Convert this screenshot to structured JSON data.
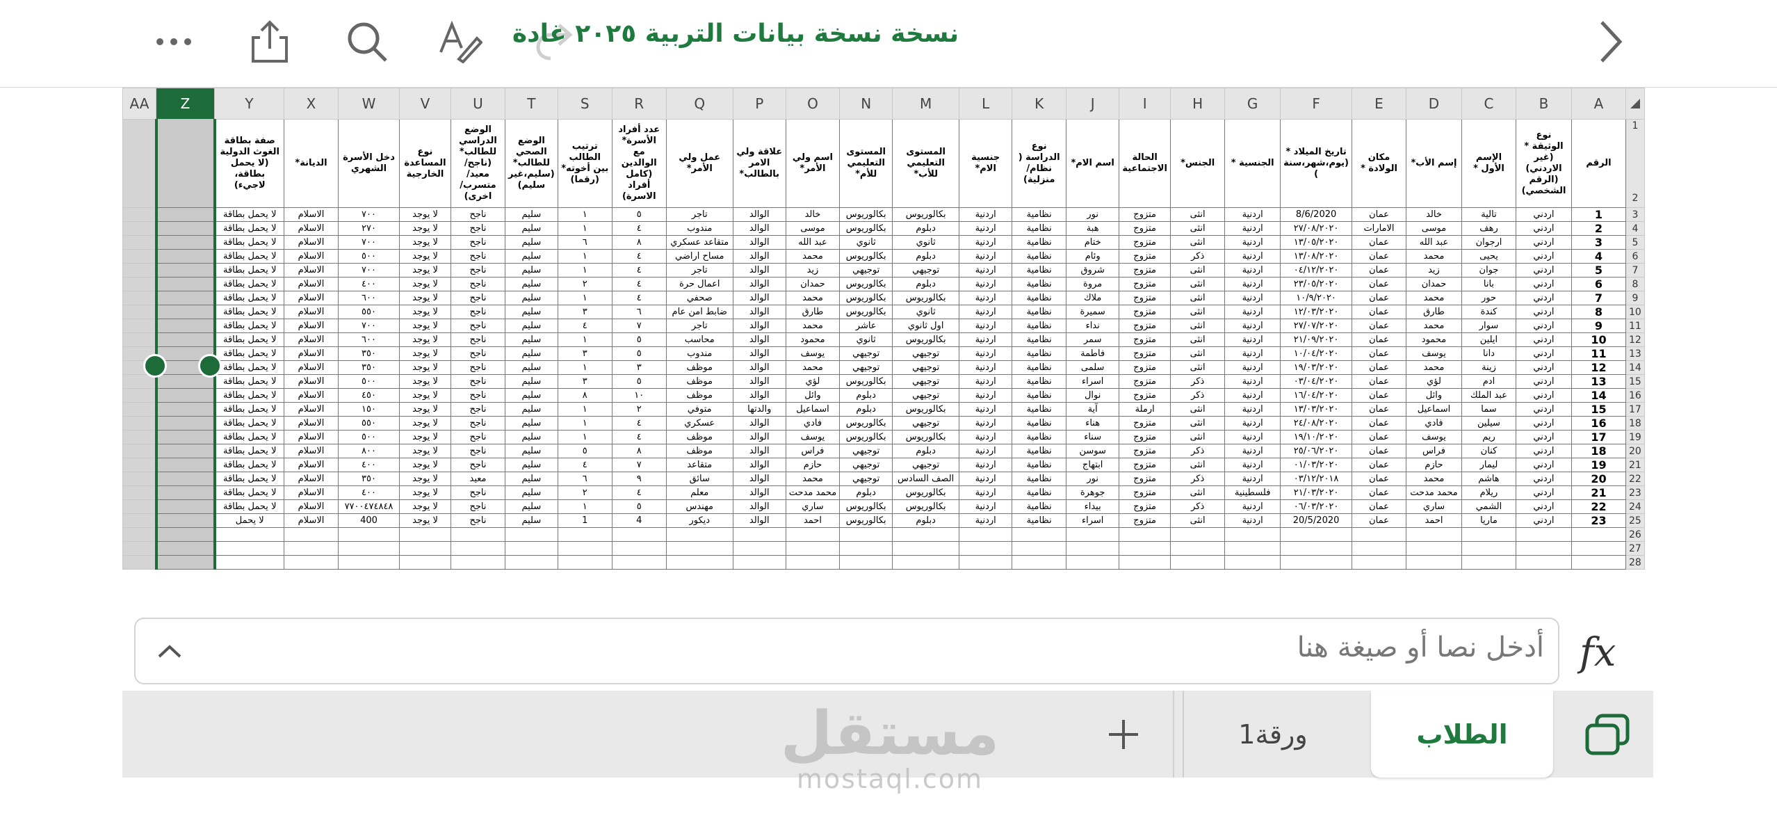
{
  "toolbar": {
    "more_icon": "ellipsis-icon",
    "share_icon": "share-icon",
    "search_icon": "search-icon",
    "format_icon": "text-format-icon",
    "redo_icon": "redo-icon",
    "forward_icon": "chevron-right-icon",
    "title": "نسخة نسخة بيانات التربية ٢٠٢٥ غادة"
  },
  "sheet": {
    "column_letters": [
      "AA",
      "Z",
      "Y",
      "X",
      "W",
      "V",
      "U",
      "T",
      "S",
      "R",
      "Q",
      "P",
      "O",
      "N",
      "M",
      "L",
      "K",
      "J",
      "I",
      "H",
      "G",
      "F",
      "E",
      "D",
      "C",
      "B",
      "A"
    ],
    "selected_column": "Z",
    "headers": [
      "",
      "",
      "صفة بطاقة الغوث الدولية (لا يحمل بطاقة، لاجيء)",
      "الديانة*",
      "دخل الأسرة الشهري",
      "نوع المساعدة الخارجية",
      "الوضع الدراسي للطالب* (ناجح/ معيد/ متسرب/ اخرى)",
      "الوضع الصحي للطالب* (سليم،غير سليم)",
      "ترتيب الطالب بين أخوته* (رقما)",
      "عدد أفراد الأسرة* مع الوالدين (كامل أفراد الاسرة)",
      "عمل ولي الأمر*",
      "علاقة ولي الامر بالطالب*",
      "اسم ولي الأمر*",
      "المستوى التعليمي للأم*",
      "المستوى التعليمي للأب*",
      "جنسية الام*",
      "نوع الدراسة ( نظام/ منزلية)",
      "اسم الام*",
      "الحالة الاجتماعية",
      "الجنس*",
      "الجنسية *",
      "تاريخ الميلاد * (يوم،شهر،سنة )",
      "مكان الولادة *",
      "إسم الأب*",
      "الإسم الأول *",
      "نوع الوثيقة * (غير الاردني) (الرقم الشخصي)",
      "الرقم"
    ],
    "header_row_numbers": [
      "1",
      "2"
    ],
    "rows": [
      {
        "n": "3",
        "c": [
          "",
          "",
          "لا يحمل بطاقة",
          "الاسلام",
          "٧٠٠",
          "لا يوجد",
          "ناجح",
          "سليم",
          "١",
          "٥",
          "تاجر",
          "الوالد",
          "خالد",
          "بكالوريوس",
          "بكالوريوس",
          "اردنية",
          "نظامية",
          "نور",
          "متزوج",
          "انثى",
          "اردنية",
          "8/6/2020",
          "عمان",
          "خالد",
          "تالية",
          "اردني",
          "1"
        ]
      },
      {
        "n": "4",
        "c": [
          "",
          "",
          "لا يحمل بطاقة",
          "الاسلام",
          "٢٧٠",
          "لا يوجد",
          "ناجح",
          "سليم",
          "١",
          "٤",
          "مندوب",
          "الوالد",
          "موسى",
          "بكالوريوس",
          "دبلوم",
          "اردنية",
          "نظامية",
          "هبة",
          "متزوج",
          "انثى",
          "اردنية",
          "٢٧/٠٨/٢٠٢٠",
          "الامارات",
          "موسى",
          "رهف",
          "اردني",
          "2"
        ]
      },
      {
        "n": "5",
        "c": [
          "",
          "",
          "لا يحمل بطاقة",
          "الاسلام",
          "٧٠٠",
          "لا يوجد",
          "ناجح",
          "سليم",
          "٦",
          "٨",
          "متقاعد عسكري",
          "الوالد",
          "عبد الله",
          "ثانوي",
          "ثانوي",
          "اردنية",
          "نظامية",
          "ختام",
          "متزوج",
          "انثى",
          "اردنية",
          "١٣/٠٥/٢٠٢٠",
          "عمان",
          "عبد الله",
          "ارجوان",
          "اردني",
          "3"
        ]
      },
      {
        "n": "6",
        "c": [
          "",
          "",
          "لا يحمل بطاقة",
          "الاسلام",
          "٥٠٠",
          "لا يوجد",
          "ناجح",
          "سليم",
          "١",
          "٤",
          "مساح اراضي",
          "الوالد",
          "محمد",
          "بكالوريوس",
          "دبلوم",
          "اردنية",
          "نظامية",
          "وئام",
          "متزوج",
          "ذكر",
          "اردنية",
          "١٣/٠٨/٢٠٢٠",
          "عمان",
          "محمد",
          "يحيى",
          "اردني",
          "4"
        ]
      },
      {
        "n": "7",
        "c": [
          "",
          "",
          "لا يحمل بطاقة",
          "الاسلام",
          "٧٠٠",
          "لا يوجد",
          "ناجح",
          "سليم",
          "١",
          "٤",
          "تاجر",
          "الوالد",
          "زيد",
          "توجيهي",
          "توجيهي",
          "اردنية",
          "نظامية",
          "شروق",
          "متزوج",
          "انثى",
          "اردنية",
          "٠٤/١٢/٢٠٢٠",
          "عمان",
          "زيد",
          "جوان",
          "اردني",
          "5"
        ]
      },
      {
        "n": "8",
        "c": [
          "",
          "",
          "لا يحمل بطاقة",
          "الاسلام",
          "٤٠٠",
          "لا يوجد",
          "ناجح",
          "سليم",
          "٢",
          "٤",
          "اعمال حرة",
          "الوالد",
          "حمدان",
          "بكالوريوس",
          "دبلوم",
          "اردنية",
          "نظامية",
          "مروة",
          "متزوج",
          "انثى",
          "اردنية",
          "٢٣/٠٥/٢٠٢٠",
          "عمان",
          "حمدان",
          "بانا",
          "اردني",
          "6"
        ]
      },
      {
        "n": "9",
        "c": [
          "",
          "",
          "لا يحمل بطاقة",
          "الاسلام",
          "٦٠٠",
          "لا يوجد",
          "ناجح",
          "سليم",
          "١",
          "٤",
          "صحفي",
          "الوالد",
          "محمد",
          "بكالوريوس",
          "بكالوريوس",
          "اردنية",
          "نظامية",
          "ملاك",
          "متزوج",
          "انثى",
          "اردنية",
          "١٠/٩/٢٠٢٠",
          "عمان",
          "محمد",
          "حور",
          "اردني",
          "7"
        ]
      },
      {
        "n": "10",
        "c": [
          "",
          "",
          "لا يحمل بطاقة",
          "الاسلام",
          "٥٥٠",
          "لا يوجد",
          "ناجح",
          "سليم",
          "٣",
          "٦",
          "ضابط امن عام",
          "الوالد",
          "طارق",
          "بكالوريوس",
          "ثانوي",
          "اردنية",
          "نظامية",
          "سميرة",
          "متزوج",
          "انثى",
          "اردنية",
          "١٢/٠٣/٢٠٢٠",
          "عمان",
          "طارق",
          "كندة",
          "اردني",
          "8"
        ]
      },
      {
        "n": "11",
        "c": [
          "",
          "",
          "لا يحمل بطاقة",
          "الاسلام",
          "٧٠٠",
          "لا يوجد",
          "ناجح",
          "سليم",
          "٤",
          "٧",
          "تاجر",
          "الوالد",
          "محمد",
          "عاشر",
          "اول ثانوي",
          "اردنية",
          "نظامية",
          "نداء",
          "متزوج",
          "انثى",
          "اردنية",
          "٢٧/٠٧/٢٠٢٠",
          "عمان",
          "محمد",
          "سوار",
          "اردني",
          "9"
        ]
      },
      {
        "n": "12",
        "c": [
          "",
          "",
          "لا يحمل بطاقة",
          "الاسلام",
          "٦٠٠",
          "لا يوجد",
          "ناجح",
          "سليم",
          "١",
          "٥",
          "محاسب",
          "الوالد",
          "محمود",
          "ثانوي",
          "بكالوريوس",
          "اردنية",
          "نظامية",
          "سمر",
          "متزوج",
          "انثى",
          "اردنية",
          "٢١/٠٩/٢٠٢٠",
          "عمان",
          "محمود",
          "ايلين",
          "اردني",
          "10"
        ]
      },
      {
        "n": "13",
        "c": [
          "",
          "",
          "لا يحمل بطاقة",
          "الاسلام",
          "٣٥٠",
          "لا يوجد",
          "ناجح",
          "سليم",
          "٣",
          "٥",
          "مندوب",
          "الوالد",
          "يوسف",
          "توجيهي",
          "توجيهي",
          "اردنية",
          "نظامية",
          "فاطمة",
          "متزوج",
          "انثى",
          "اردنية",
          "١٠/٠٤/٢٠٢٠",
          "عمان",
          "يوسف",
          "دانا",
          "اردني",
          "11"
        ]
      },
      {
        "n": "14",
        "c": [
          "",
          "",
          "لا يحمل بطاقة",
          "الاسلام",
          "٣٥٠",
          "لا يوجد",
          "ناجح",
          "سليم",
          "١",
          "٣",
          "موظف",
          "الوالد",
          "محمد",
          "توجيهي",
          "توجيهي",
          "اردنية",
          "نظامية",
          "سلمى",
          "متزوج",
          "انثى",
          "اردنية",
          "١٩/٠٣/٢٠٢٠",
          "عمان",
          "محمد",
          "زينة",
          "اردني",
          "12"
        ]
      },
      {
        "n": "15",
        "c": [
          "",
          "",
          "لا يحمل بطاقة",
          "الاسلام",
          "٥٠٠",
          "لا يوجد",
          "ناجح",
          "سليم",
          "٣",
          "٥",
          "موظف",
          "الوالد",
          "لؤي",
          "بكالوريوس",
          "توجيهي",
          "اردنية",
          "نظامية",
          "اسراء",
          "متزوج",
          "ذكر",
          "اردنية",
          "٠٣/٠٤/٢٠٢٠",
          "عمان",
          "لؤي",
          "ادم",
          "اردني",
          "13"
        ]
      },
      {
        "n": "16",
        "c": [
          "",
          "",
          "لا يحمل بطاقة",
          "الاسلام",
          "٤٥٠",
          "لا يوجد",
          "ناجح",
          "سليم",
          "٨",
          "١٠",
          "موظف",
          "الوالد",
          "وائل",
          "دبلوم",
          "توجيهي",
          "اردنية",
          "نظامية",
          "نوال",
          "متزوج",
          "ذكر",
          "اردنية",
          "١٦/٠٤/٢٠٢٠",
          "عمان",
          "وائل",
          "عبد الملك",
          "اردني",
          "14"
        ]
      },
      {
        "n": "17",
        "c": [
          "",
          "",
          "لا يحمل بطاقة",
          "الاسلام",
          "١٥٠",
          "لا يوجد",
          "ناجح",
          "سليم",
          "١",
          "٢",
          "متوفي",
          "والدتها",
          "اسماعيل",
          "دبلوم",
          "بكالوريوس",
          "اردنية",
          "نظامية",
          "آية",
          "ارملة",
          "انثى",
          "اردنية",
          "١٣/٠٣/٢٠٢٠",
          "عمان",
          "اسماعيل",
          "سما",
          "اردني",
          "15"
        ]
      },
      {
        "n": "18",
        "c": [
          "",
          "",
          "لا يحمل بطاقة",
          "الاسلام",
          "٥٥٠",
          "لا يوجد",
          "ناجح",
          "سليم",
          "١",
          "٤",
          "عسكري",
          "الوالد",
          "فادي",
          "بكالوريوس",
          "توجيهي",
          "اردنية",
          "نظامية",
          "هناء",
          "متزوج",
          "انثى",
          "اردنية",
          "٢٤/٠٨/٢٠٢٠",
          "عمان",
          "فادي",
          "سيلين",
          "اردني",
          "16"
        ]
      },
      {
        "n": "19",
        "c": [
          "",
          "",
          "لا يحمل بطاقة",
          "الاسلام",
          "٥٠٠",
          "لا يوجد",
          "ناجح",
          "سليم",
          "١",
          "٤",
          "موظف",
          "الوالد",
          "يوسف",
          "بكالوريوس",
          "بكالوريوس",
          "اردنية",
          "نظامية",
          "سناء",
          "متزوج",
          "انثى",
          "اردنية",
          "١٩/١٠/٢٠٢٠",
          "عمان",
          "يوسف",
          "ريم",
          "اردني",
          "17"
        ]
      },
      {
        "n": "20",
        "c": [
          "",
          "",
          "لا يحمل بطاقة",
          "الاسلام",
          "٨٠٠",
          "لا يوجد",
          "ناجح",
          "سليم",
          "٥",
          "٨",
          "موظف",
          "الوالد",
          "فراس",
          "توجيهي",
          "دبلوم",
          "اردنية",
          "نظامية",
          "سوسن",
          "متزوج",
          "ذكر",
          "اردنية",
          "٢٥/٠٦/٢٠٢٠",
          "عمان",
          "فراس",
          "كنان",
          "اردني",
          "18"
        ]
      },
      {
        "n": "21",
        "c": [
          "",
          "",
          "لا يحمل بطاقة",
          "الاسلام",
          "٤٠٠",
          "لا يوجد",
          "ناجح",
          "سليم",
          "٤",
          "٧",
          "متقاعد",
          "الوالد",
          "حازم",
          "توجيهي",
          "توجيهي",
          "اردنية",
          "نظامية",
          "ابتهاج",
          "متزوج",
          "انثى",
          "اردنية",
          "٠١/٠٣/٢٠٢٠",
          "عمان",
          "حازم",
          "ليمار",
          "اردني",
          "19"
        ]
      },
      {
        "n": "22",
        "c": [
          "",
          "",
          "لا يحمل بطاقة",
          "الاسلام",
          "٣٥٠",
          "لا يوجد",
          "معيد",
          "سليم",
          "٦",
          "٩",
          "سائق",
          "الوالد",
          "محمد",
          "توجيهي",
          "الصف السادس",
          "اردنية",
          "نظامية",
          "نور",
          "متزوج",
          "ذكر",
          "اردنية",
          "٠٣/١٢/٢٠١٨",
          "عمان",
          "محمد",
          "هاشم",
          "اردني",
          "20"
        ]
      },
      {
        "n": "23",
        "c": [
          "",
          "",
          "لا يحمل بطاقة",
          "الاسلام",
          "٤٠٠",
          "لا يوجد",
          "ناجح",
          "سليم",
          "٢",
          "٤",
          "معلم",
          "الوالد",
          "محمد مدحت",
          "دبلوم",
          "بكالوريوس",
          "اردنية",
          "نظامية",
          "جوهرة",
          "متزوج",
          "انثى",
          "فلسطينية",
          "٢١/٠٣/٢٠٢٠",
          "عمان",
          "محمد مدحت",
          "ريلام",
          "اردني",
          "21"
        ]
      },
      {
        "n": "24",
        "c": [
          "",
          "",
          "لا يحمل بطاقة",
          "الاسلام",
          "٧٧٠٠٤٧٤٨٤٨",
          "لا يوجد",
          "ناجح",
          "سليم",
          "١",
          "٥",
          "مهندس",
          "الوالد",
          "ساري",
          "بكالوريوس",
          "بكالوريوس",
          "اردنية",
          "نظامية",
          "بيداء",
          "متزوج",
          "ذكر",
          "اردنية",
          "٠٦/٠٣/٢٠٢٠",
          "عمان",
          "ساري",
          "الشمي",
          "اردني",
          "22"
        ]
      },
      {
        "n": "25",
        "c": [
          "",
          "",
          "لا يحمل",
          "الاسلام",
          "400",
          "لا يوجد",
          "ناجح",
          "سليم",
          "1",
          "4",
          "ديكور",
          "الوالد",
          "احمد",
          "بكالوريوس",
          "دبلوم",
          "اردنية",
          "نظامية",
          "اسراء",
          "متزوج",
          "انثى",
          "اردنية",
          "20/5/2020",
          "عمان",
          "احمد",
          "ماريا",
          "اردني",
          "23"
        ]
      }
    ],
    "empty_rows": [
      "26",
      "27",
      "28"
    ]
  },
  "formula_bar": {
    "placeholder": "أدخل نصا أو صيغة هنا",
    "expand_icon": "chevron-up-icon",
    "fx_label": "fx"
  },
  "tabs": {
    "switch_icon": "sheets-switch-icon",
    "active_sheet": "الطلاب",
    "sheet2": "ورقة1",
    "add_icon": "plus-icon"
  },
  "watermark": {
    "arabic": "مستقل",
    "latin": "mostaql.com"
  },
  "colors": {
    "accent": "#1d6b39",
    "title": "#1f7a3e"
  }
}
